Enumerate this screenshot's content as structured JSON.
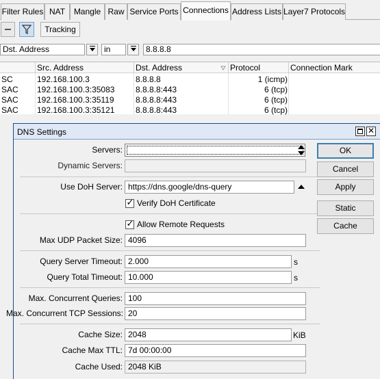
{
  "tabs": [
    "Filter Rules",
    "NAT",
    "Mangle",
    "Raw",
    "Service Ports",
    "Connections",
    "Address Lists",
    "Layer7 Protocols"
  ],
  "toolbar": {
    "tracking_label": "Tracking"
  },
  "filter": {
    "field": "Dst. Address",
    "operator": "in",
    "value": "8.8.8.8"
  },
  "table": {
    "columns": [
      "",
      "Src. Address",
      "Dst. Address",
      "Protocol",
      "Connection Mark"
    ],
    "rows": [
      [
        "SC",
        "192.168.100.3",
        "8.8.8.8",
        "1 (icmp)",
        ""
      ],
      [
        "SAC",
        "192.168.100.3:35083",
        "8.8.8.8:443",
        "6 (tcp)",
        ""
      ],
      [
        "SAC",
        "192.168.100.3:35119",
        "8.8.8.8:443",
        "6 (tcp)",
        ""
      ],
      [
        "SAC",
        "192.168.100.3:35121",
        "8.8.8.8:443",
        "6 (tcp)",
        ""
      ]
    ]
  },
  "dialog": {
    "title": "DNS Settings",
    "servers_label": "Servers:",
    "servers_value": "",
    "dynamic_servers_label": "Dynamic Servers:",
    "dynamic_servers_value": "",
    "doh_label": "Use DoH Server:",
    "doh_value": "https://dns.google/dns-query",
    "verify_doh_label": "Verify DoH Certificate",
    "verify_doh_checked": true,
    "allow_remote_label": "Allow Remote Requests",
    "allow_remote_checked": true,
    "max_udp_label": "Max UDP Packet Size:",
    "max_udp_value": "4096",
    "query_server_timeout_label": "Query Server Timeout:",
    "query_server_timeout_value": "2.000",
    "query_total_timeout_label": "Query Total Timeout:",
    "query_total_timeout_value": "10.000",
    "seconds_unit": "s",
    "max_concurrent_queries_label": "Max. Concurrent Queries:",
    "max_concurrent_queries_value": "100",
    "max_concurrent_tcp_label": "Max. Concurrent TCP Sessions:",
    "max_concurrent_tcp_value": "20",
    "cache_size_label": "Cache Size:",
    "cache_size_value": "2048",
    "cache_size_unit": "KiB",
    "cache_max_ttl_label": "Cache Max TTL:",
    "cache_max_ttl_value": "7d 00:00:00",
    "cache_used_label": "Cache Used:",
    "cache_used_value": "2048 KiB",
    "buttons": {
      "ok": "OK",
      "cancel": "Cancel",
      "apply": "Apply",
      "static": "Static",
      "cache": "Cache"
    }
  }
}
